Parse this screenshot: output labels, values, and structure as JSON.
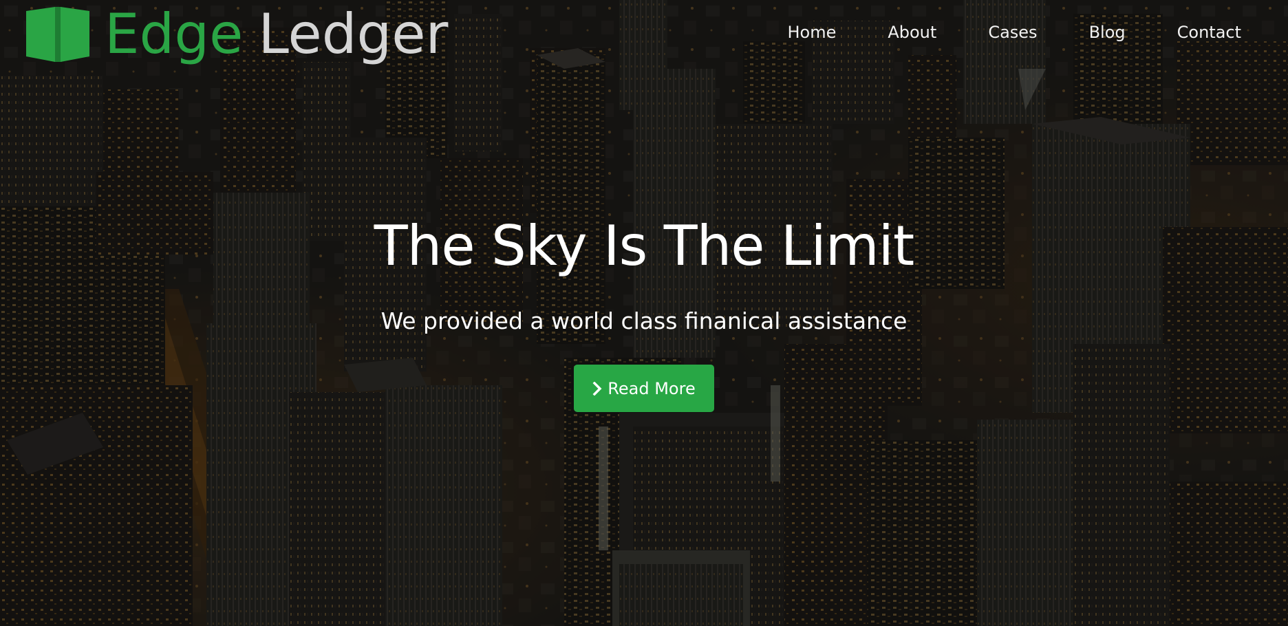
{
  "brand": {
    "name_part1": "Edge",
    "name_part2": "Ledger",
    "icon": "open-book-icon"
  },
  "nav": {
    "items": [
      {
        "label": "Home"
      },
      {
        "label": "About"
      },
      {
        "label": "Cases"
      },
      {
        "label": "Blog"
      },
      {
        "label": "Contact"
      }
    ]
  },
  "hero": {
    "title": "The Sky Is The Limit",
    "subtitle": "We provided a world class finanical assistance",
    "button_label": "Read More",
    "button_icon": "chevron-right-icon"
  },
  "colors": {
    "brand_green": "#2aa545",
    "button_green": "#28a745",
    "ledger_gray": "#d5d5d5",
    "nav_text": "#f2f2f2"
  }
}
